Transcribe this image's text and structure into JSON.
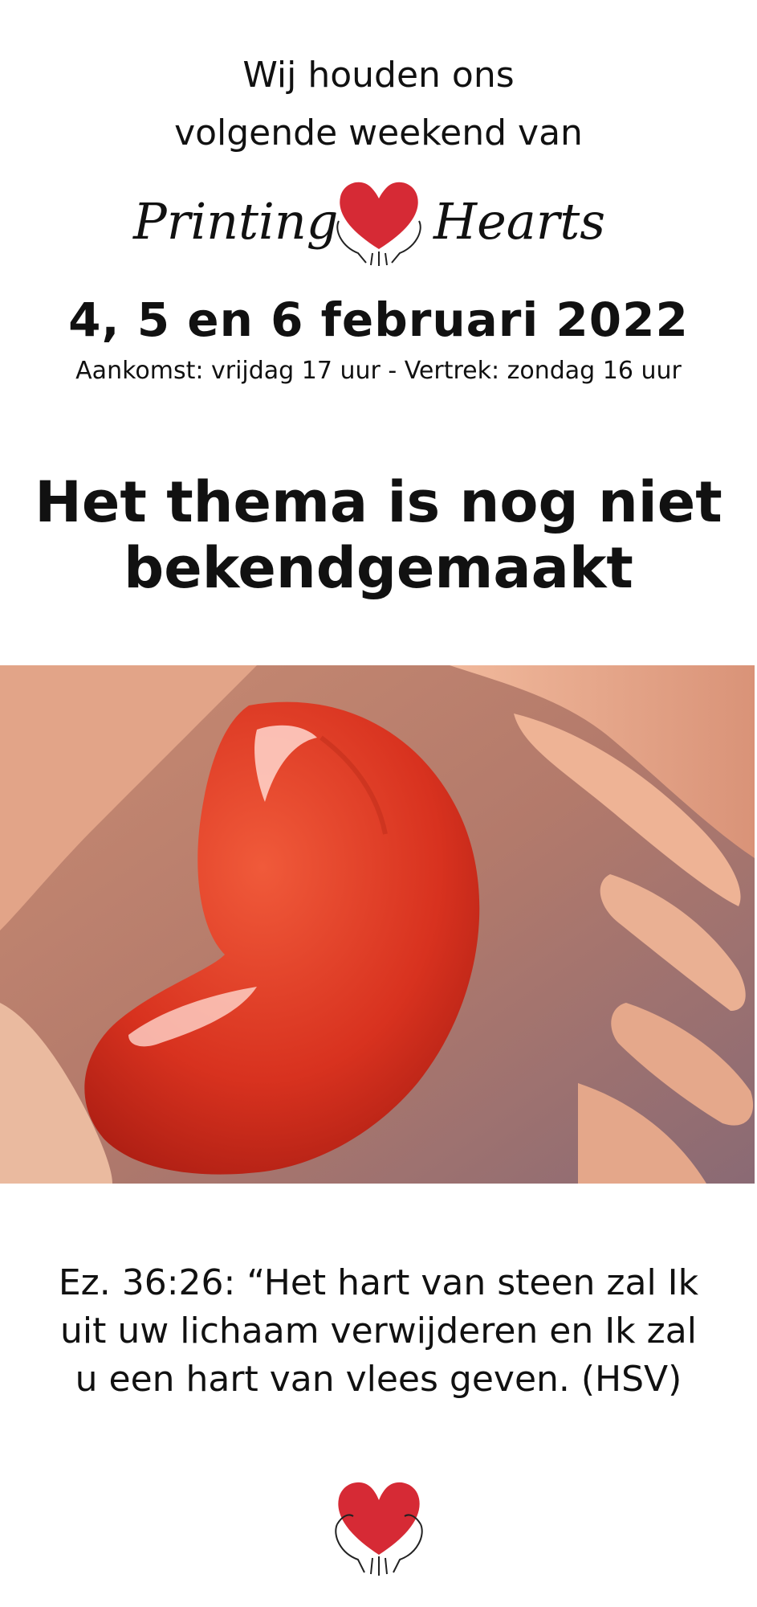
{
  "intro": {
    "line1": "Wij houden ons",
    "line2": "volgende weekend van"
  },
  "brand": {
    "word1": "Printing",
    "word2": "Hearts",
    "heart_color": "#d62a35",
    "icon": "heart-in-hands-icon"
  },
  "event": {
    "dates": "4, 5 en 6 februari 2022",
    "times": "Aankomst: vrijdag 17 uur - Vertrek: zondag 16 uur"
  },
  "theme": {
    "line1": "Het thema is nog niet",
    "line2": "bekendgemaakt"
  },
  "photo": {
    "icon": "red-heart-in-hands-photo",
    "heart_color": "#d8321f",
    "hands_color": "#e8a183"
  },
  "verse": {
    "line1": "Ez. 36:26: “Het hart van steen zal Ik",
    "line2": "uit uw lichaam verwijderen en Ik zal",
    "line3": "u een hart van vlees geven. (HSV)"
  },
  "footer": {
    "icon": "heart-in-hands-icon"
  }
}
